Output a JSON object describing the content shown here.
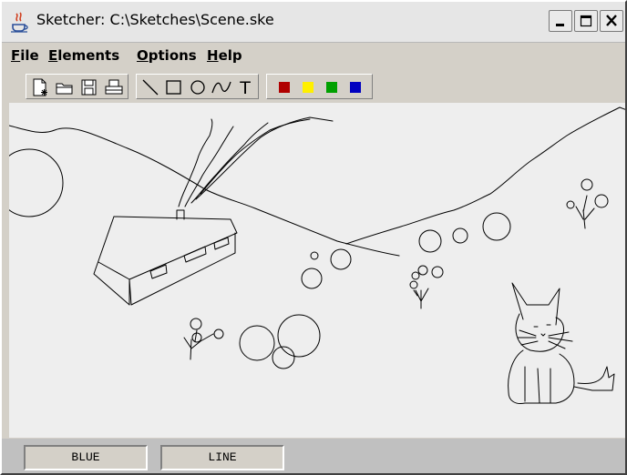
{
  "window": {
    "title": "Sketcher: C:\\Sketches\\Scene.ske",
    "controls": [
      "minimize",
      "maximize",
      "close"
    ]
  },
  "menu": {
    "file": {
      "mnemonic": "F",
      "rest": "ile"
    },
    "elements": {
      "mnemonic": "E",
      "rest": "lements"
    },
    "options": {
      "mnemonic": "O",
      "rest": "ptions"
    },
    "help": {
      "mnemonic": "H",
      "rest": "elp"
    }
  },
  "toolbar": {
    "file_tools": [
      "new-file-icon",
      "open-file-icon",
      "save-file-icon",
      "print-icon"
    ],
    "element_tools": [
      "line-icon",
      "rectangle-icon",
      "circle-icon",
      "curve-icon",
      "text-tool-icon"
    ],
    "text_tool_glyph": "T",
    "color_tools": [
      {
        "name": "red",
        "color": "#b00000"
      },
      {
        "name": "yellow",
        "color": "#fff000"
      },
      {
        "name": "green",
        "color": "#00a000"
      },
      {
        "name": "blue",
        "color": "#0000c0"
      }
    ]
  },
  "canvas": {
    "stroke_color": "#000000",
    "background": "#eeeeee"
  },
  "status": {
    "color": "BLUE",
    "element": "LINE"
  }
}
